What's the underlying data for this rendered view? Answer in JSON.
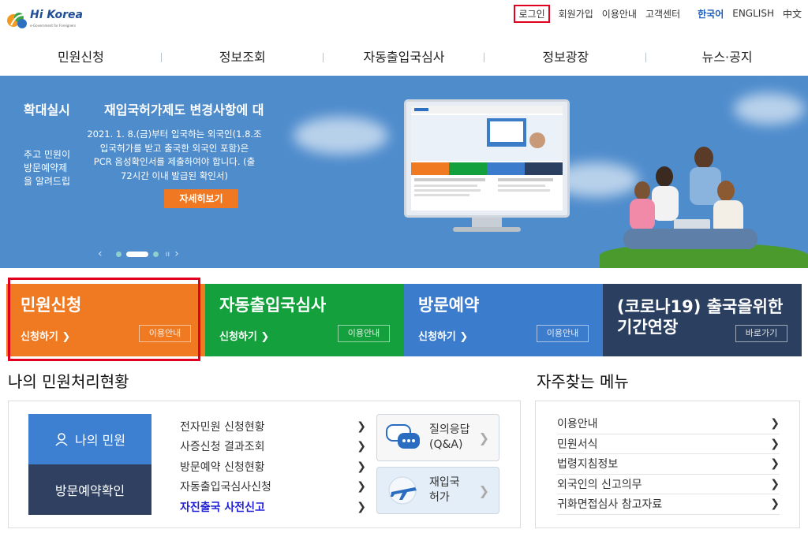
{
  "header": {
    "logo_text": "Hi Korea",
    "logo_sub": "e-Government for Foreigners",
    "util": {
      "login": "로그인",
      "signup": "회원가입",
      "guide": "이용안내",
      "support": "고객센터",
      "lang_ko": "한국어",
      "lang_en": "ENGLISH",
      "lang_zh": "中文"
    }
  },
  "gnb": [
    "민원신청",
    "정보조회",
    "자동출입국심사",
    "정보광장",
    "뉴스·공지"
  ],
  "banner": {
    "title1": "확대실시",
    "title2": "재입국허가제도 변경사항에 대",
    "left_lines": [
      "추고 민원이",
      "방문예약제",
      "을 알려드립"
    ],
    "body_lines": [
      "2021. 1. 8.(금)부터 입국하는 외국인(1.8.조",
      "입국허가를 받고 출국한 외국인 포함)은",
      "PCR 음성확인서를 제출하여야 합니다. (출",
      "72시간 이내 발급된 확인서)"
    ],
    "button": "자세히보기",
    "prev": "‹",
    "next": "›",
    "pause": "ıı"
  },
  "tiles": [
    {
      "title": "민원신청",
      "link": "신청하기 ❯",
      "guide": "이용안내"
    },
    {
      "title": "자동출입국심사",
      "link": "신청하기 ❯",
      "guide": "이용안내"
    },
    {
      "title": "방문예약",
      "link": "신청하기 ❯",
      "guide": "이용안내"
    },
    {
      "title": "(코로나19) 출국을위한 기간연장",
      "guide": "바로가기"
    }
  ],
  "status": {
    "title": "나의 민원처리현황",
    "my_button": "나의 민원",
    "visit_button": "방문예약확인",
    "items": [
      "전자민원 신청현황",
      "사증신청 결과조회",
      "방문예약 신청현황",
      "자동출입국심사신청",
      "자진출국 사전신고"
    ],
    "qna": [
      "질의응답",
      "(Q&A)"
    ],
    "reentry": [
      "재입국",
      "허가"
    ]
  },
  "freq": {
    "title": "자주찾는 메뉴",
    "items": [
      "이용안내",
      "민원서식",
      "법령지침정보",
      "외국인의 신고의무",
      "귀화면접심사 참고자료"
    ]
  },
  "colors": {
    "orange": "#ef7a22",
    "green": "#14a03c",
    "blue": "#3c7ccc",
    "navy": "#2b3f60",
    "banner": "#4f8ccc",
    "highlight": "#e1001d"
  }
}
